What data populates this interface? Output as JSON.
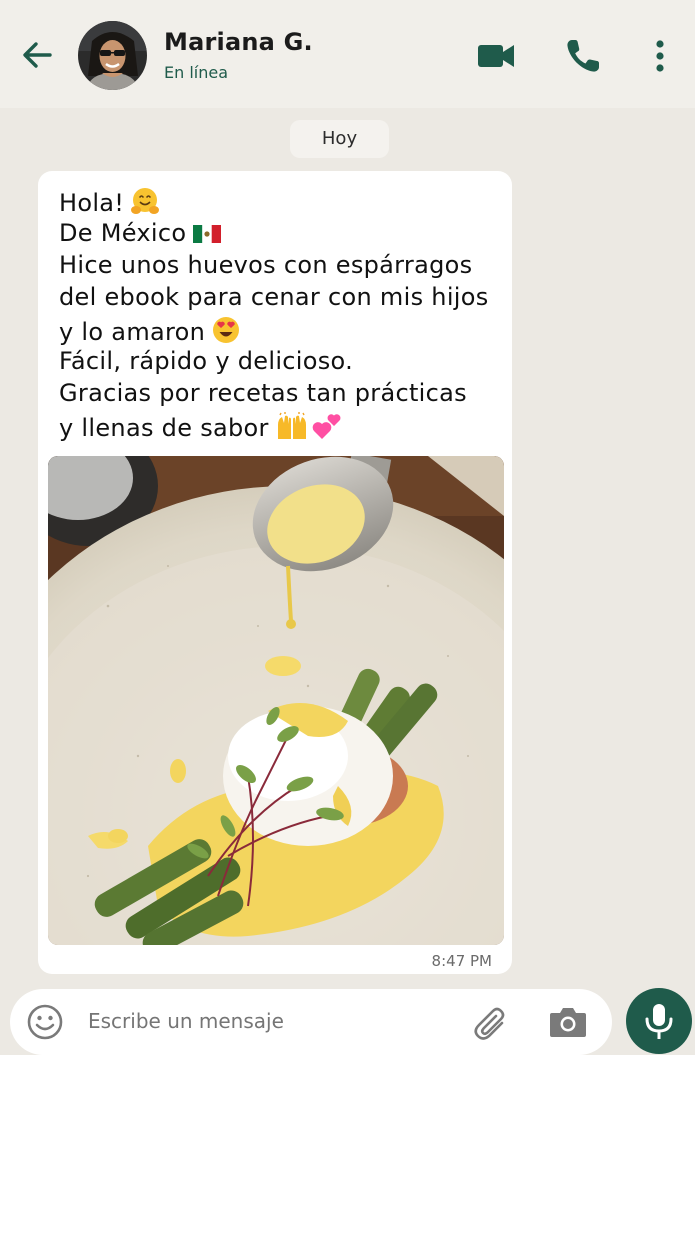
{
  "header": {
    "contact_name": "Mariana G.",
    "status": "En línea",
    "icons": [
      "back-arrow-icon",
      "video-call-icon",
      "phone-icon",
      "more-vert-icon"
    ]
  },
  "date_chip": "Hoy",
  "message": {
    "lines": [
      "Hola!",
      "De México",
      "Hice unos huevos con espárragos",
      "del ebook para cenar con mis hijos",
      "y lo amaron",
      "Fácil, rápido y delicioso.",
      "Gracias por recetas tan prácticas",
      "y llenas de sabor"
    ],
    "emojis": [
      "hugging-face-emoji",
      "mexico-flag-emoji",
      "heart-eyes-emoji",
      "raised-hands-emoji",
      "two-hearts-emoji"
    ],
    "time": "8:47 PM"
  },
  "composer": {
    "placeholder": "Escribe un mensaje",
    "icons": [
      "emoji-icon",
      "attach-icon",
      "camera-icon",
      "mic-icon"
    ]
  },
  "colors": {
    "accent": "#1f5b4b",
    "chat_bg": "#ece9e3",
    "header_bg": "#f1efea",
    "bubble_bg": "#ffffff"
  }
}
